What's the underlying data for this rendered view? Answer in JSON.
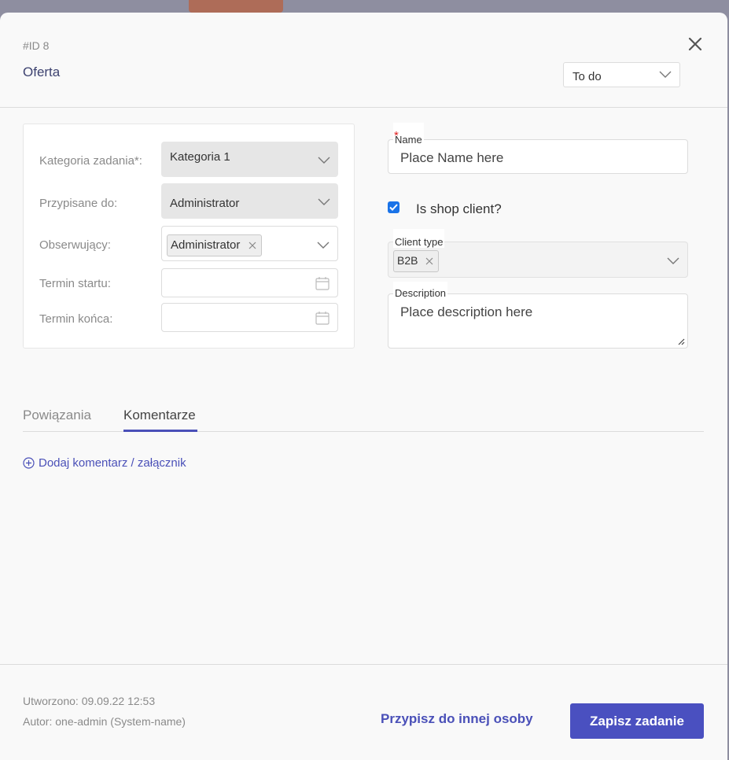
{
  "header": {
    "id_label": "#ID 8",
    "title": "Oferta",
    "status": "To do"
  },
  "left_form": {
    "category": {
      "label": "Kategoria zadania*:",
      "value": "Kategoria 1"
    },
    "assigned": {
      "label": "Przypisane do:",
      "value": "Administrator"
    },
    "observers": {
      "label": "Obserwujący:",
      "tags": [
        "Administrator"
      ]
    },
    "start": {
      "label": "Termin startu:",
      "value": ""
    },
    "end": {
      "label": "Termin końca:",
      "value": ""
    }
  },
  "right_form": {
    "name": {
      "label": "Name",
      "required_mark": "*",
      "placeholder": "Place Name here"
    },
    "shop_client": {
      "label": "Is shop client?",
      "checked": true
    },
    "client_type": {
      "label": "Client type",
      "tags": [
        "B2B"
      ]
    },
    "description": {
      "label": "Description",
      "placeholder": "Place description here"
    }
  },
  "tabs": [
    {
      "label": "Powiązania",
      "active": false
    },
    {
      "label": "Komentarze",
      "active": true
    }
  ],
  "comments": {
    "add_label": "Dodaj komentarz / załącznik"
  },
  "footer": {
    "created": "Utworzono: 09.09.22 12:53",
    "author": "Autor: one-admin (System-name)",
    "assign_other_label": "Przypisz do innej osoby",
    "save_label": "Zapisz zadanie"
  },
  "colors": {
    "accent": "#4a50c0",
    "checkbox": "#1a73e8",
    "required": "#e02020"
  }
}
